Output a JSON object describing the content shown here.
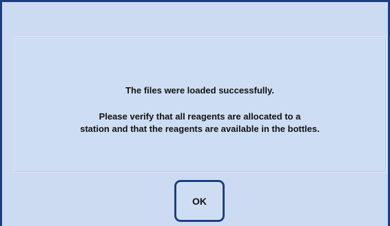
{
  "dialog": {
    "message_title": "The files were loaded successfully.",
    "message_line_1": "Please verify that all reagents are allocated to a",
    "message_line_2": "station and that the reagents are available in the bottles.",
    "ok_label": "OK"
  },
  "colors": {
    "frame_border": "#1a3e86",
    "background": "#ccdaf2",
    "panel_background": "#cdddf3"
  }
}
